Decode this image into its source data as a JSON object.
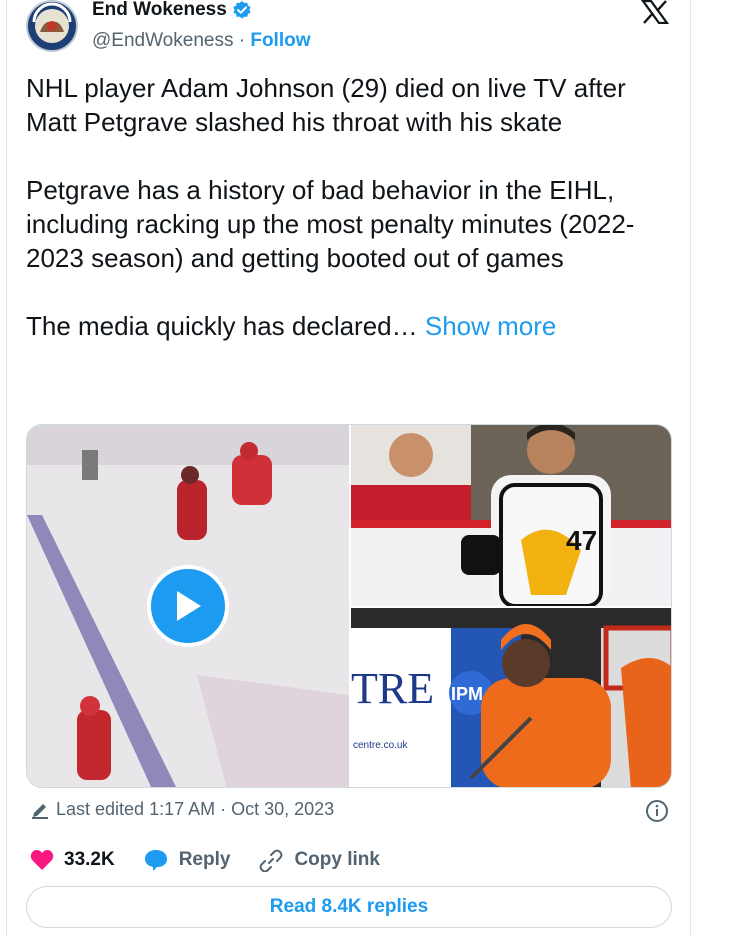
{
  "author": {
    "display_name": "End Wokeness",
    "handle": "@EndWokeness",
    "separator": "·",
    "follow_label": "Follow"
  },
  "tweet": {
    "text": "NHL player Adam Johnson (29) died on live TV after Matt Petgrave slashed his throat with his skate\n\nPetgrave has a history of bad behavior in the EIHL, including racking up the most penalty minutes (2022-2023 season) and getting booted out of games\n\nThe media quickly has declared… ",
    "show_more_label": "Show more"
  },
  "media": {
    "img1_jersey_number": "47",
    "img2_banner_text": "TRE",
    "img2_badge_text": "IPM",
    "img2_url_text": "centre.co.uk"
  },
  "meta": {
    "edited_text": "Last edited 1:17 AM · Oct 30, 2023"
  },
  "actions": {
    "likes": "33.2K",
    "reply_label": "Reply",
    "copy_link_label": "Copy link"
  },
  "read_replies_label": "Read 8.4K replies",
  "colors": {
    "accent": "#1d9bf0",
    "like": "#f91880",
    "secondary_text": "#536471"
  },
  "icons": [
    "avatar",
    "verified-badge-icon",
    "x-logo-icon",
    "play-icon",
    "pencil-icon",
    "info-icon",
    "heart-icon",
    "reply-bubble-icon",
    "link-icon"
  ]
}
